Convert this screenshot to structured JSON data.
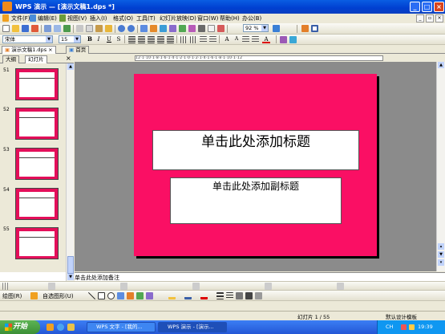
{
  "titlebar": {
    "title": "WPS 演示 — [演示文稿1.dps *]",
    "buttons": [
      "_",
      "□",
      "×"
    ]
  },
  "menubar": {
    "items": [
      "文件(F)",
      "编辑(E)",
      "视图(V)",
      "插入(I)",
      "格式(O)",
      "工具(T)",
      "幻灯片放映(D)",
      "窗口(W)",
      "帮助(H)",
      "办公(B)"
    ]
  },
  "standard_toolbar": {
    "zoom": "92 %"
  },
  "format_toolbar": {
    "font_name": "宋体",
    "font_size": "15",
    "bold": "B",
    "italic": "I",
    "underline": "U",
    "shadow": "S",
    "font_color": "A"
  },
  "doc_tabs": {
    "items": [
      {
        "label": "演示文稿1.dps",
        "close": "×"
      },
      {
        "label": "首页"
      }
    ]
  },
  "left_panel": {
    "tabs": [
      "大纲",
      "幻灯片"
    ],
    "close": "×",
    "slide_numbers": [
      "51",
      "52",
      "53",
      "54",
      "55"
    ]
  },
  "ruler": {
    "text": "12·1·10·1·8·1·6·1·4·1·2·1·0·1·2·1·4·1·6·1·8·1·10·1·12"
  },
  "slide": {
    "title_placeholder": "单击此处添加标题",
    "subtitle_placeholder": "单击此处添加副标题",
    "background_color": "#fa0f64"
  },
  "notes": {
    "placeholder": "单击此处添加备注"
  },
  "drawing_toolbar": {
    "draw_label": "绘图(R)",
    "autoshapes_label": "自选图形(U)"
  },
  "status": {
    "slide_counter": "幻灯片 1 / 55",
    "template": "默认设计模板"
  },
  "taskbar": {
    "start": "开始",
    "tasks": [
      "WPS 文字 - [我的...",
      "WPS 演示 - [演示..."
    ],
    "ime": "CH",
    "clock": "19:39"
  }
}
